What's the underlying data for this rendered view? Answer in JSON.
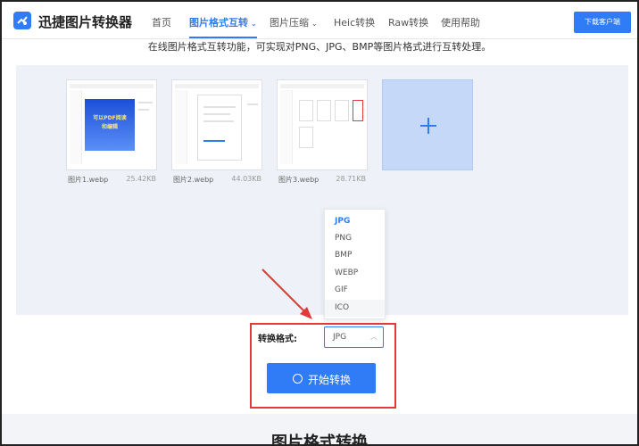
{
  "header": {
    "brand": "迅捷图片转换器",
    "nav": [
      {
        "label": "首页",
        "active": false,
        "caret": ""
      },
      {
        "label": "图片格式互转",
        "active": true,
        "caret": "⌄"
      },
      {
        "label": "图片压缩",
        "active": false,
        "caret": "⌄"
      },
      {
        "label": "Heic转换",
        "active": false,
        "caret": ""
      },
      {
        "label": "Raw转换",
        "active": false,
        "caret": ""
      },
      {
        "label": "使用帮助",
        "active": false,
        "caret": ""
      }
    ],
    "download_label": "下载客户端"
  },
  "main": {
    "subtitle": "在线图片格式互转功能，可实现对PNG、JPG、BMP等图片格式进行互转处理。",
    "thumbnails": [
      {
        "name": "图片1.webp",
        "size": "25.42KB",
        "promo": [
          "可以PDF阅读",
          "和编辑"
        ]
      },
      {
        "name": "图片2.webp",
        "size": "44.03KB"
      },
      {
        "name": "图片3.webp",
        "size": "28.71KB"
      }
    ],
    "add_icon": "plus-icon"
  },
  "format_dropdown": {
    "options": [
      "JPG",
      "PNG",
      "BMP",
      "WEBP",
      "GIF",
      "ICO"
    ],
    "selected": "JPG",
    "hovered": "ICO"
  },
  "convert": {
    "format_label": "转换格式:",
    "format_value": "JPG",
    "start_label": "开始转换"
  },
  "bottom": {
    "title": "图片格式转换"
  },
  "colors": {
    "accent": "#2f7cf6",
    "annotation_red": "#e03a3a",
    "upload_bg": "#eef1f7",
    "add_tile_bg": "#c6d8f8"
  }
}
